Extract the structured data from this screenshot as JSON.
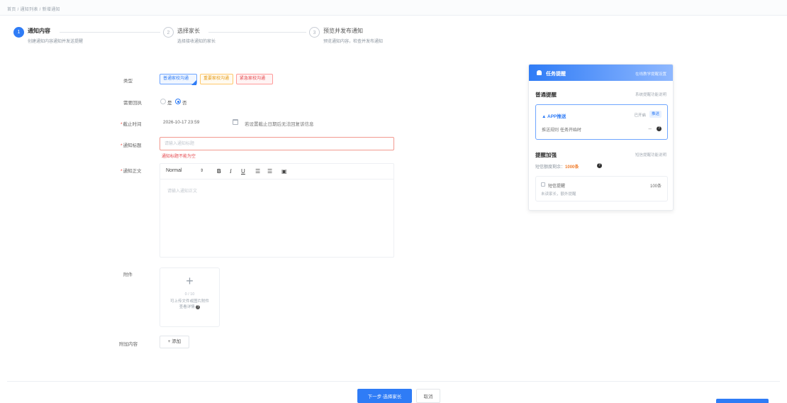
{
  "breadcrumb": "首页 / 通知列表 / 新增通知",
  "steps": [
    {
      "num": "1",
      "title": "通知内容",
      "desc": "创建通知内容通知并发送提醒"
    },
    {
      "num": "2",
      "title": "选择家长",
      "desc": "选择接收通知的家长"
    },
    {
      "num": "3",
      "title": "预览并发布通知",
      "desc": "预览通知内容，检查并发布通知"
    }
  ],
  "form": {
    "type_label": "类型",
    "type_tags": [
      "普通家校沟通",
      "重要家校沟通",
      "紧急家校沟通"
    ],
    "receipt_label": "需要回执",
    "receipt_yes": "是",
    "receipt_no": "否",
    "deadline_label": "截止时间",
    "deadline_value": "2026-10-17 23:59",
    "deadline_tip": "若设置截止日期后无法回复该信息",
    "title_label": "通知标题",
    "title_placeholder": "请输入通知标题",
    "title_error": "通知标题不能为空",
    "body_label": "通知正文",
    "editor_font": "Normal",
    "body_placeholder": "请输入通知正文",
    "attach_label": "附件",
    "upload_count": "0 / 10",
    "upload_hint": "可上传文件或图片附件",
    "upload_hint_more": "查看详情",
    "extra_label": "附加内容",
    "add_label": "+ 添加"
  },
  "actions": {
    "next": "下一步·选择家长",
    "cancel": "取消"
  },
  "reminder": {
    "header": "任务提醒",
    "header_right": "在线教学提醒设置",
    "normal_title": "普通提醒",
    "normal_note": "系统提醒功能说明",
    "app_name": "APP推送",
    "app_status": "已开启",
    "app_pill": "推送",
    "send_label": "推送规则",
    "send_value": "任务开始时",
    "enhance_title": "提醒加强",
    "enhance_note": "短信提醒功能说明",
    "quota_label": "短信额度剩余：",
    "quota_value": "1000条",
    "sms_name": "短信提醒",
    "sms_count": "100条",
    "sms_desc": "未读家长，额外提醒"
  }
}
